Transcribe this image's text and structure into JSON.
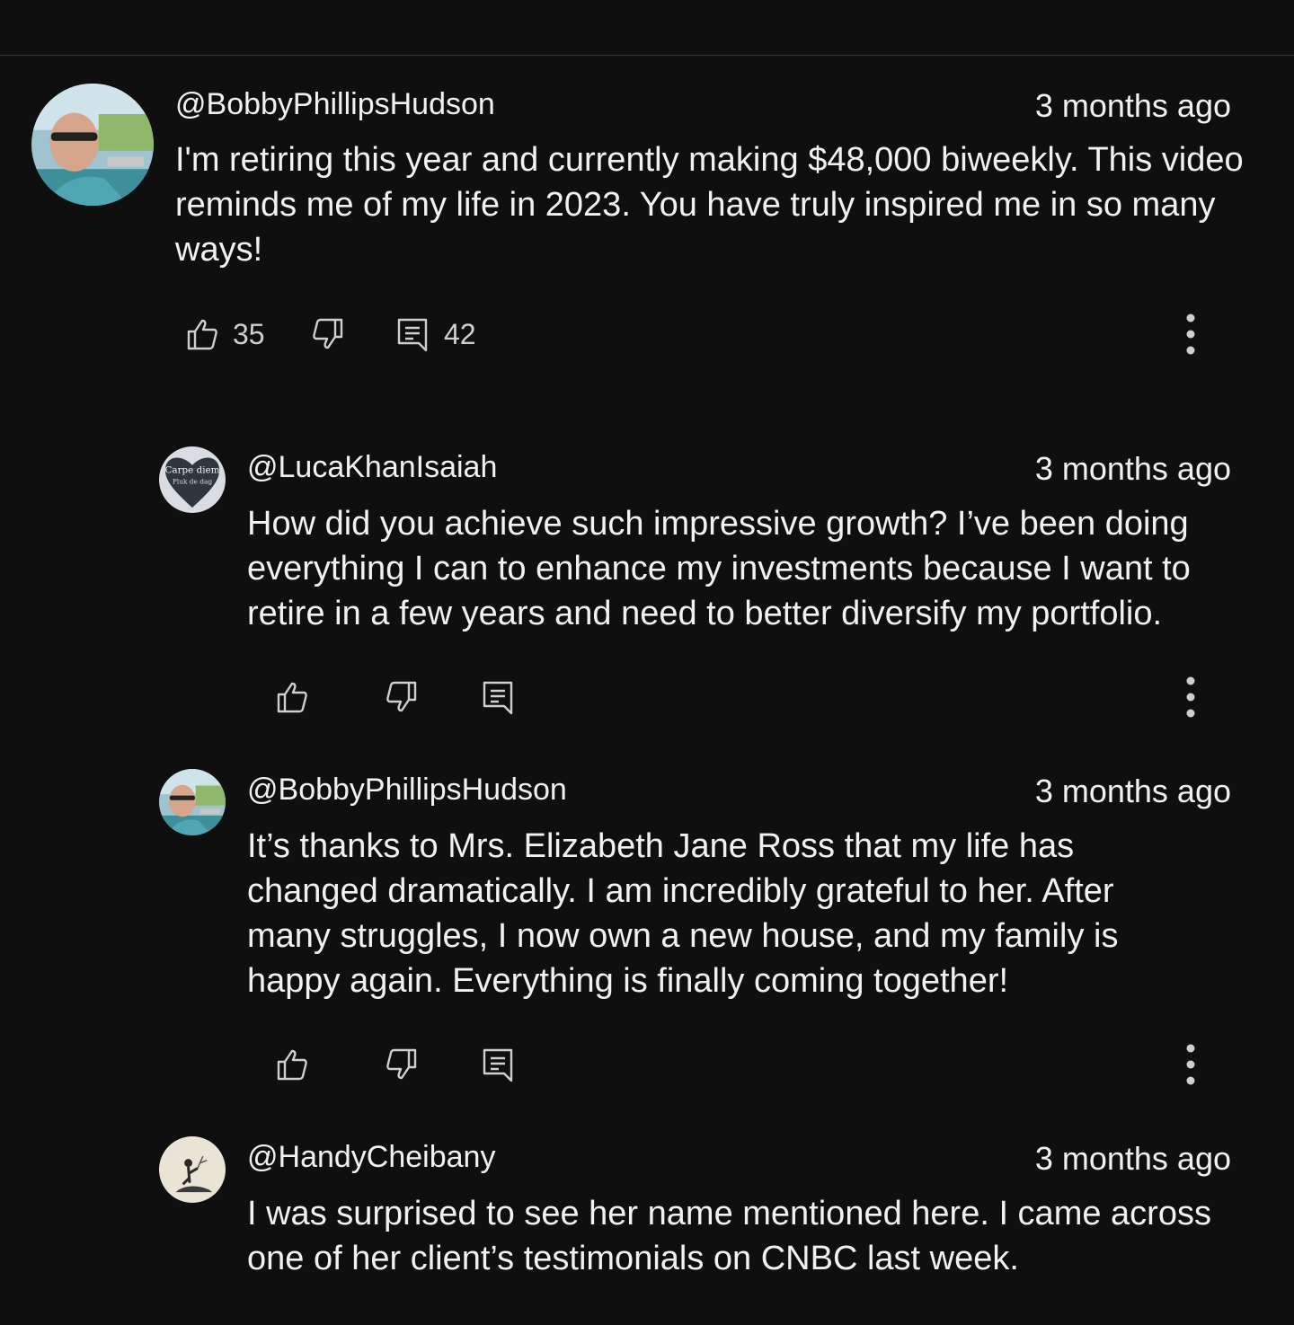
{
  "comments": [
    {
      "author": "@BobbyPhillipsHudson",
      "time": "3 months ago",
      "text": "I'm retiring this year and currently making $48,000 biweekly. This video reminds me of my life in 2023. You have truly inspired me in so many ways!",
      "likes": "35",
      "replies": "42"
    },
    {
      "author": "@LucaKhanIsaiah",
      "time": "3 months ago",
      "text": "How did you achieve such impressive growth? I’ve been doing everything I can to enhance my investments because I want to retire in a few years and need to better diversify my portfolio.",
      "avatar_text": "Carpe diem",
      "avatar_subtext": "Pluk de dag"
    },
    {
      "author": "@BobbyPhillipsHudson",
      "time": "3 months ago",
      "text": "It’s thanks to Mrs. Elizabeth Jane Ross that my life has changed dramatically. I am incredibly grateful to her. After many struggles, I now own a new house, and my family is happy again. Everything is finally coming together!"
    },
    {
      "author": "@HandyCheibany",
      "time": "3 months ago",
      "text": "I was surprised to see her name mentioned here. I came across one of her client’s testimonials on CNBC last week."
    }
  ],
  "icons": {
    "like": "thumbs-up-icon",
    "dislike": "thumbs-down-icon",
    "reply": "reply-icon",
    "more": "more-vertical-icon"
  },
  "colors": {
    "background": "#0f0f0f",
    "text": "#f1f1f1",
    "icon": "#cfcfcf"
  }
}
